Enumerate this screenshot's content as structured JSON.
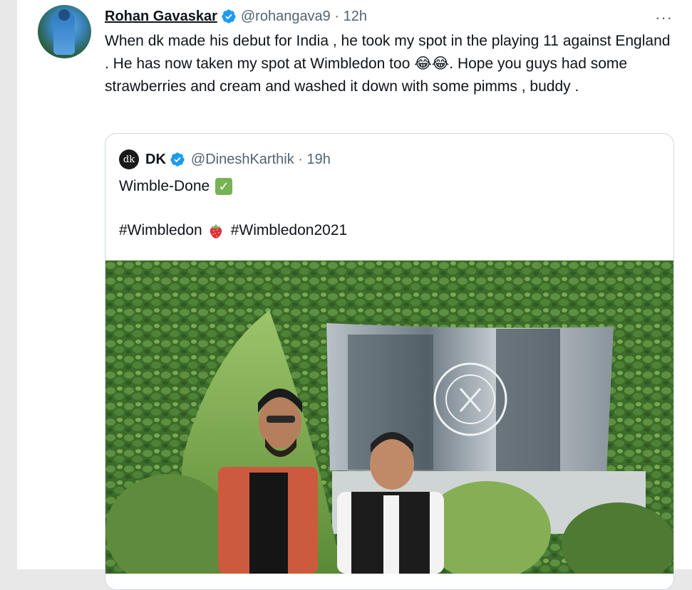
{
  "tweet": {
    "author_name": "Rohan Gavaskar",
    "handle_time": "@rohangava9 · 12h",
    "text": "When dk made his debut for India , he took my spot in the playing 11 against England . He has now taken my spot at Wimbledon too 😂😂. Hope you guys had some strawberries and cream and washed it down with some pimms , buddy .",
    "more_icon": "···"
  },
  "quote": {
    "avatar_text": "dk",
    "author_name": "DK",
    "handle_time": "@DineshKarthik · 19h",
    "line1": "Wimble-Done",
    "check_icon": "✓",
    "hashtag1": "#Wimbledon",
    "hashtag2": "#Wimbledon2021"
  },
  "colors": {
    "verified": "#1d9bf0",
    "secondary_text": "#536471",
    "border": "#cfd9de"
  }
}
